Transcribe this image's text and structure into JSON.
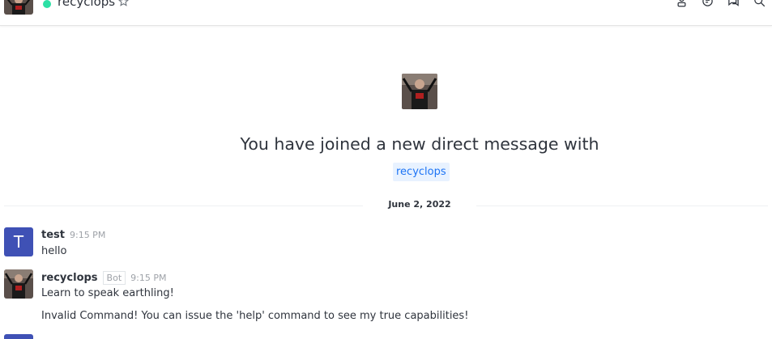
{
  "header": {
    "title": "recyclops",
    "status_color": "#2de0a5",
    "icons": [
      "user-info-icon",
      "threads-icon",
      "discussions-icon",
      "search-icon"
    ]
  },
  "intro": {
    "title": "You have joined a new direct message with",
    "mention": "recyclops"
  },
  "divider": {
    "date": "June 2, 2022"
  },
  "messages": [
    {
      "avatar_letter": "T",
      "avatar_color": "#3f51b5",
      "user": "test",
      "time": "9:15 PM",
      "lines": [
        "hello"
      ]
    },
    {
      "user": "recyclops",
      "badge": "Bot",
      "time": "9:15 PM",
      "lines": [
        "Learn to speak earthling!",
        "Invalid Command! You can issue the 'help' command to see my true capabilities!"
      ]
    }
  ]
}
